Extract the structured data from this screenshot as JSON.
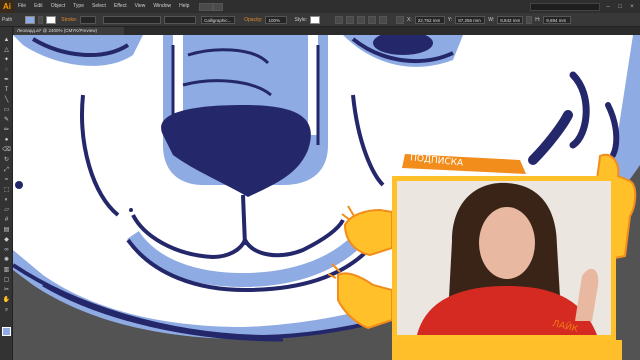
{
  "app": {
    "logo": "Ai",
    "menus": [
      "File",
      "Edit",
      "Object",
      "Type",
      "Select",
      "Effect",
      "View",
      "Window",
      "Help"
    ]
  },
  "control_bar": {
    "path_label": "Path",
    "stroke_label": "Stroke:",
    "brush_preset": "Calligraphic...",
    "opacity_label": "Opacity:",
    "opacity_value": "100%",
    "style_label": "Style:",
    "x_field": "22,752 mm",
    "y_field": "87,256 mm",
    "w_field": "8,842 mm",
    "h_field": "9,694 mm"
  },
  "document": {
    "tab_label": "Леопард.ai* @ 2400% (CMYK/Preview)"
  },
  "colors": {
    "navy": "#24286b",
    "light_blue": "#8fabe3",
    "white": "#ffffff",
    "canvas_bg": "#535353",
    "accent_orange": "#f28c1b",
    "accent_yellow": "#ffc02a"
  },
  "webcam": {
    "sticker_top": "ПОДПИСКА",
    "sticker_bottom": "ЛАЙК"
  }
}
